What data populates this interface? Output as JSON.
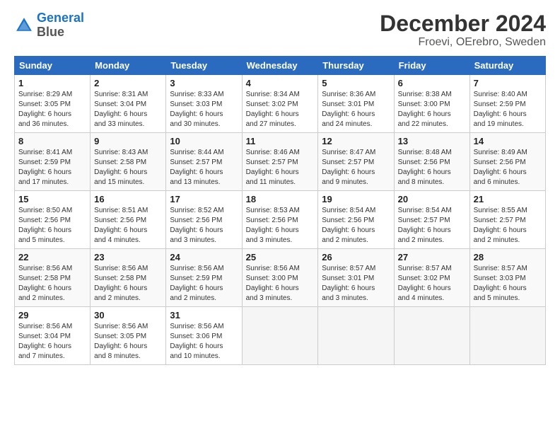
{
  "logo": {
    "line1": "General",
    "line2": "Blue"
  },
  "title": "December 2024",
  "location": "Froevi, OErebro, Sweden",
  "weekdays": [
    "Sunday",
    "Monday",
    "Tuesday",
    "Wednesday",
    "Thursday",
    "Friday",
    "Saturday"
  ],
  "weeks": [
    [
      {
        "day": "1",
        "info": "Sunrise: 8:29 AM\nSunset: 3:05 PM\nDaylight: 6 hours\nand 36 minutes."
      },
      {
        "day": "2",
        "info": "Sunrise: 8:31 AM\nSunset: 3:04 PM\nDaylight: 6 hours\nand 33 minutes."
      },
      {
        "day": "3",
        "info": "Sunrise: 8:33 AM\nSunset: 3:03 PM\nDaylight: 6 hours\nand 30 minutes."
      },
      {
        "day": "4",
        "info": "Sunrise: 8:34 AM\nSunset: 3:02 PM\nDaylight: 6 hours\nand 27 minutes."
      },
      {
        "day": "5",
        "info": "Sunrise: 8:36 AM\nSunset: 3:01 PM\nDaylight: 6 hours\nand 24 minutes."
      },
      {
        "day": "6",
        "info": "Sunrise: 8:38 AM\nSunset: 3:00 PM\nDaylight: 6 hours\nand 22 minutes."
      },
      {
        "day": "7",
        "info": "Sunrise: 8:40 AM\nSunset: 2:59 PM\nDaylight: 6 hours\nand 19 minutes."
      }
    ],
    [
      {
        "day": "8",
        "info": "Sunrise: 8:41 AM\nSunset: 2:59 PM\nDaylight: 6 hours\nand 17 minutes."
      },
      {
        "day": "9",
        "info": "Sunrise: 8:43 AM\nSunset: 2:58 PM\nDaylight: 6 hours\nand 15 minutes."
      },
      {
        "day": "10",
        "info": "Sunrise: 8:44 AM\nSunset: 2:57 PM\nDaylight: 6 hours\nand 13 minutes."
      },
      {
        "day": "11",
        "info": "Sunrise: 8:46 AM\nSunset: 2:57 PM\nDaylight: 6 hours\nand 11 minutes."
      },
      {
        "day": "12",
        "info": "Sunrise: 8:47 AM\nSunset: 2:57 PM\nDaylight: 6 hours\nand 9 minutes."
      },
      {
        "day": "13",
        "info": "Sunrise: 8:48 AM\nSunset: 2:56 PM\nDaylight: 6 hours\nand 8 minutes."
      },
      {
        "day": "14",
        "info": "Sunrise: 8:49 AM\nSunset: 2:56 PM\nDaylight: 6 hours\nand 6 minutes."
      }
    ],
    [
      {
        "day": "15",
        "info": "Sunrise: 8:50 AM\nSunset: 2:56 PM\nDaylight: 6 hours\nand 5 minutes."
      },
      {
        "day": "16",
        "info": "Sunrise: 8:51 AM\nSunset: 2:56 PM\nDaylight: 6 hours\nand 4 minutes."
      },
      {
        "day": "17",
        "info": "Sunrise: 8:52 AM\nSunset: 2:56 PM\nDaylight: 6 hours\nand 3 minutes."
      },
      {
        "day": "18",
        "info": "Sunrise: 8:53 AM\nSunset: 2:56 PM\nDaylight: 6 hours\nand 3 minutes."
      },
      {
        "day": "19",
        "info": "Sunrise: 8:54 AM\nSunset: 2:56 PM\nDaylight: 6 hours\nand 2 minutes."
      },
      {
        "day": "20",
        "info": "Sunrise: 8:54 AM\nSunset: 2:57 PM\nDaylight: 6 hours\nand 2 minutes."
      },
      {
        "day": "21",
        "info": "Sunrise: 8:55 AM\nSunset: 2:57 PM\nDaylight: 6 hours\nand 2 minutes."
      }
    ],
    [
      {
        "day": "22",
        "info": "Sunrise: 8:56 AM\nSunset: 2:58 PM\nDaylight: 6 hours\nand 2 minutes."
      },
      {
        "day": "23",
        "info": "Sunrise: 8:56 AM\nSunset: 2:58 PM\nDaylight: 6 hours\nand 2 minutes."
      },
      {
        "day": "24",
        "info": "Sunrise: 8:56 AM\nSunset: 2:59 PM\nDaylight: 6 hours\nand 2 minutes."
      },
      {
        "day": "25",
        "info": "Sunrise: 8:56 AM\nSunset: 3:00 PM\nDaylight: 6 hours\nand 3 minutes."
      },
      {
        "day": "26",
        "info": "Sunrise: 8:57 AM\nSunset: 3:01 PM\nDaylight: 6 hours\nand 3 minutes."
      },
      {
        "day": "27",
        "info": "Sunrise: 8:57 AM\nSunset: 3:02 PM\nDaylight: 6 hours\nand 4 minutes."
      },
      {
        "day": "28",
        "info": "Sunrise: 8:57 AM\nSunset: 3:03 PM\nDaylight: 6 hours\nand 5 minutes."
      }
    ],
    [
      {
        "day": "29",
        "info": "Sunrise: 8:56 AM\nSunset: 3:04 PM\nDaylight: 6 hours\nand 7 minutes."
      },
      {
        "day": "30",
        "info": "Sunrise: 8:56 AM\nSunset: 3:05 PM\nDaylight: 6 hours\nand 8 minutes."
      },
      {
        "day": "31",
        "info": "Sunrise: 8:56 AM\nSunset: 3:06 PM\nDaylight: 6 hours\nand 10 minutes."
      },
      null,
      null,
      null,
      null
    ]
  ]
}
